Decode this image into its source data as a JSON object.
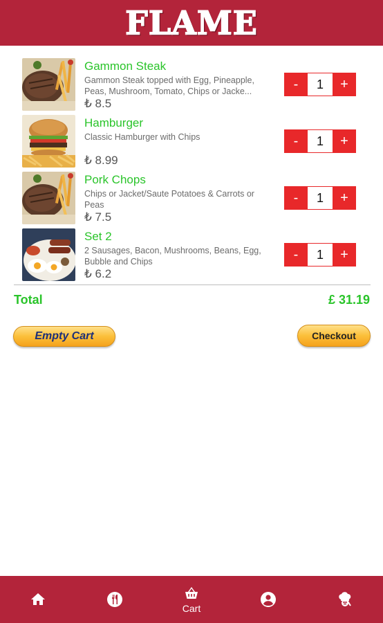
{
  "header": {
    "logo_text": "FLAME"
  },
  "cart": {
    "items": [
      {
        "name": "Gammon Steak",
        "description": "Gammon Steak topped with Egg, Pineapple, Peas, Mushroom, Tomato, Chips or Jacke...",
        "price": "₺ 8.5",
        "qty": "1",
        "image": "steak-chips"
      },
      {
        "name": "Hamburger",
        "description": "Classic Hamburger with Chips",
        "price": "₺ 8.99",
        "qty": "1",
        "image": "burger-chips"
      },
      {
        "name": "Pork Chops",
        "description": "Chips or Jacket/Saute Potatoes & Carrots or Peas",
        "price": "₺ 7.5",
        "qty": "1",
        "image": "steak-chips"
      },
      {
        "name": "Set 2",
        "description": "2 Sausages, Bacon, Mushrooms, Beans, Egg, Bubble and Chips",
        "price": "₺ 6.2",
        "qty": "1",
        "image": "fried-breakfast"
      }
    ],
    "minus_label": "-",
    "plus_label": "+",
    "total_label": "Total",
    "total_value": "£ 31.19",
    "empty_cart_label": "Empty Cart",
    "checkout_label": "Checkout"
  },
  "bottom_nav": {
    "items": [
      {
        "icon": "home-icon",
        "label": ""
      },
      {
        "icon": "restaurant-icon",
        "label": ""
      },
      {
        "icon": "basket-icon",
        "label": "Cart"
      },
      {
        "icon": "account-icon",
        "label": ""
      },
      {
        "icon": "chef-icon",
        "label": ""
      }
    ]
  },
  "colors": {
    "brand": "#b3243a",
    "accent_green": "#2ac42a",
    "qty_button": "#e8282a"
  }
}
